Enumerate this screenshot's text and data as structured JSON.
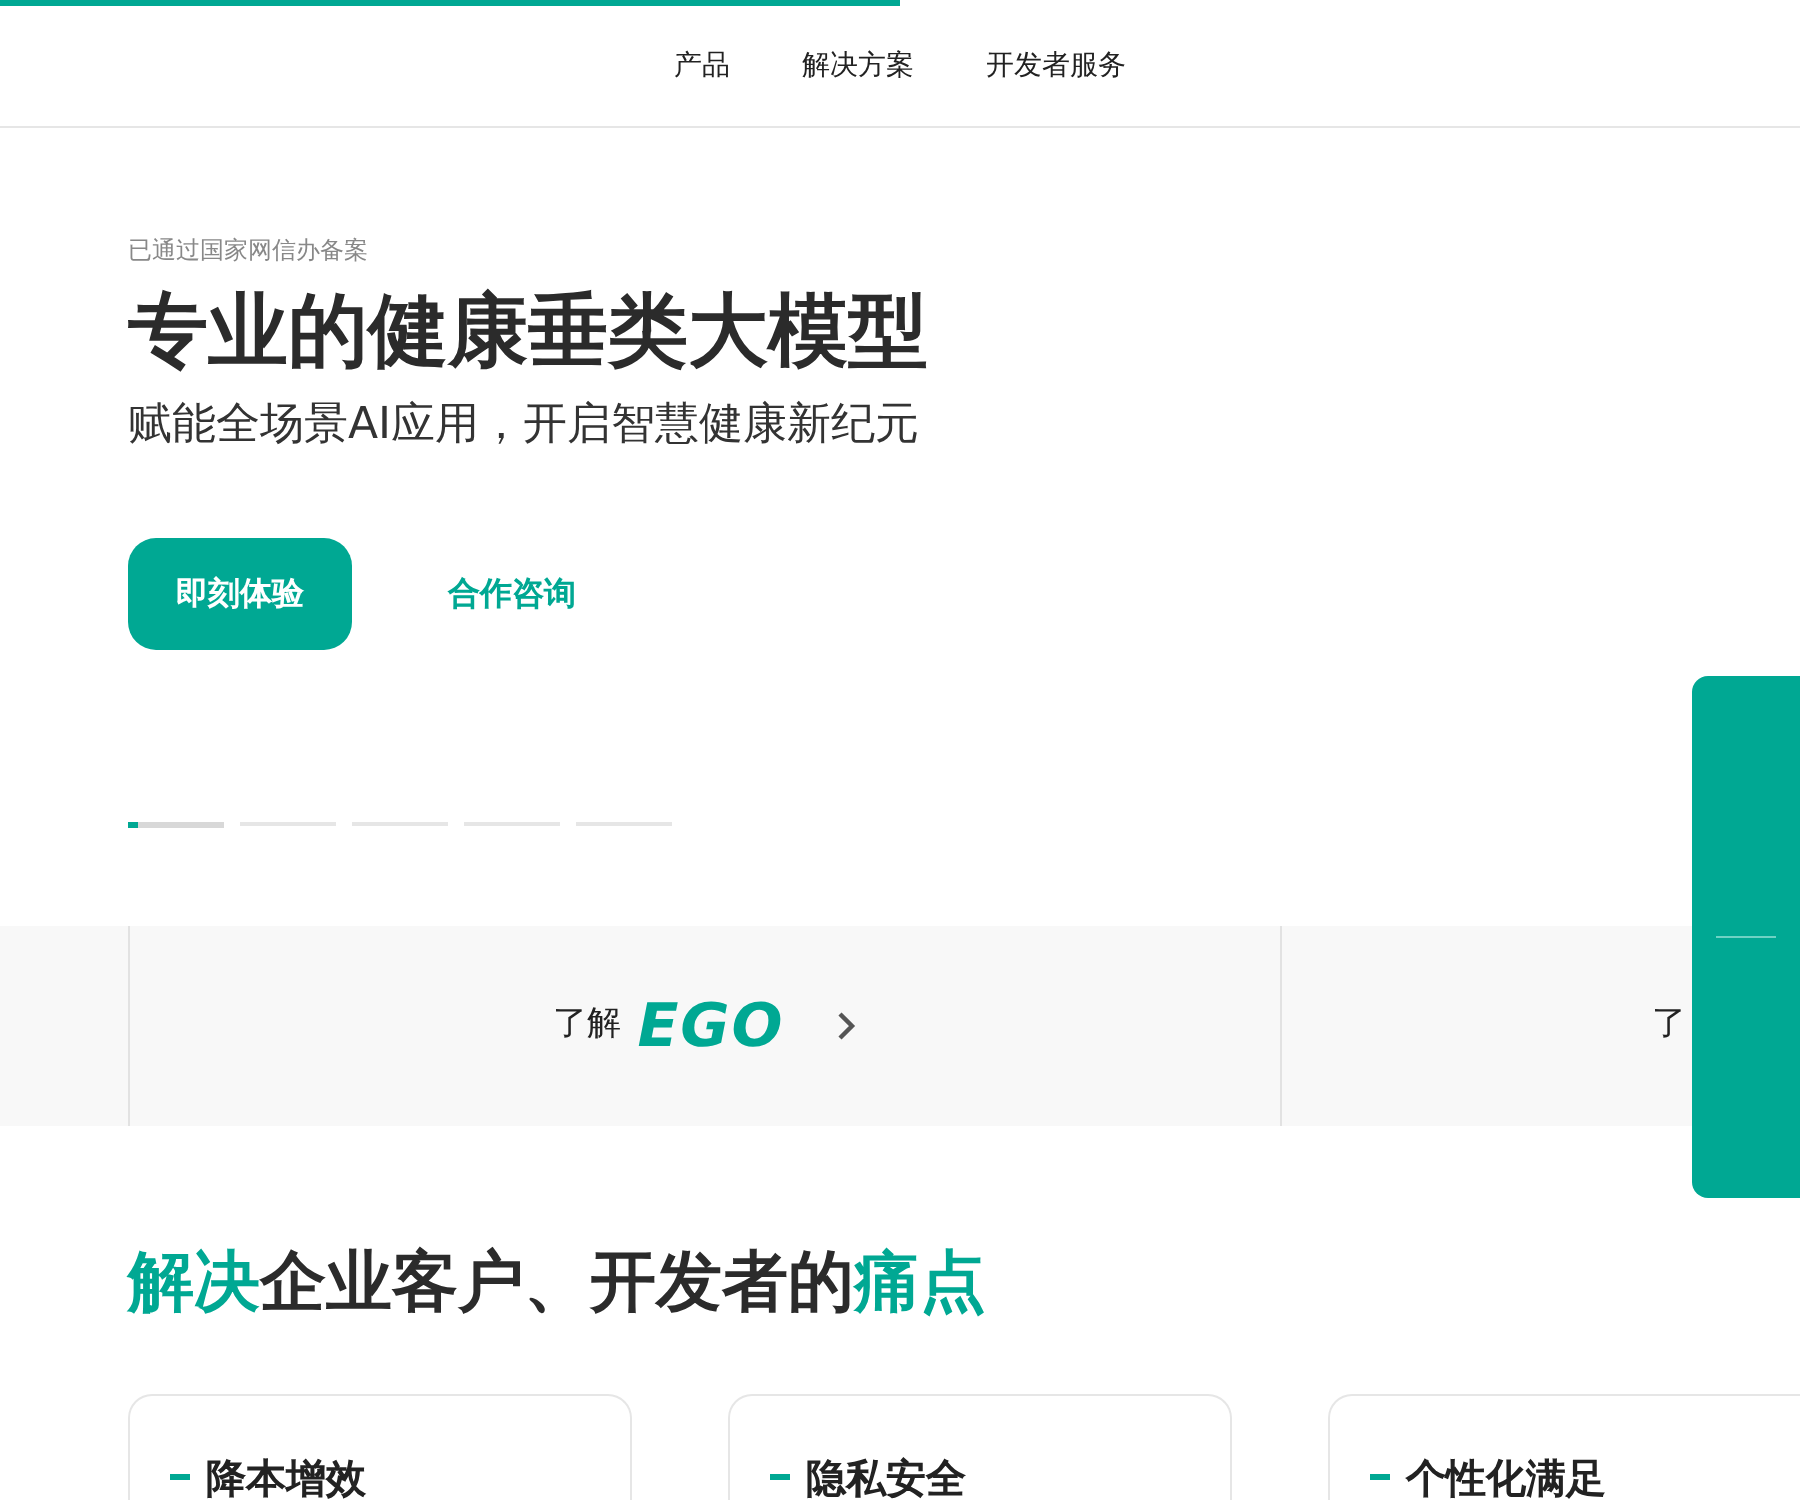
{
  "loading_bar": {
    "level": 0.5
  },
  "nav": {
    "items": [
      {
        "label": "产品"
      },
      {
        "label": "解决方案"
      },
      {
        "label": "开发者服务"
      }
    ]
  },
  "hero": {
    "badge": "已通过国家网信办备案",
    "title": "专业的健康垂类大模型",
    "subtitle": "赋能全场景AI应用，开启智慧健康新纪元",
    "buttons": [
      {
        "label": "即刻体验",
        "kind": "primary"
      },
      {
        "label": "合作咨询",
        "kind": "link"
      }
    ],
    "indicators": [
      {
        "selected": true,
        "level": 0.1
      },
      {
        "selected": false
      },
      {
        "selected": false
      },
      {
        "selected": false
      },
      {
        "selected": false
      }
    ]
  },
  "banner": [
    {
      "prefix": "了解",
      "logo": "EGO"
    },
    {
      "prefix": "了"
    }
  ],
  "pain_points": {
    "title_parts": [
      {
        "text": "解决",
        "highlight": true
      },
      {
        "text": "企业客户、开发者的",
        "highlight": false
      },
      {
        "text": "痛点",
        "highlight": true
      }
    ],
    "cards": [
      {
        "title": "降本增效"
      },
      {
        "title": "隐私安全"
      },
      {
        "title": "个性化满足"
      }
    ]
  }
}
